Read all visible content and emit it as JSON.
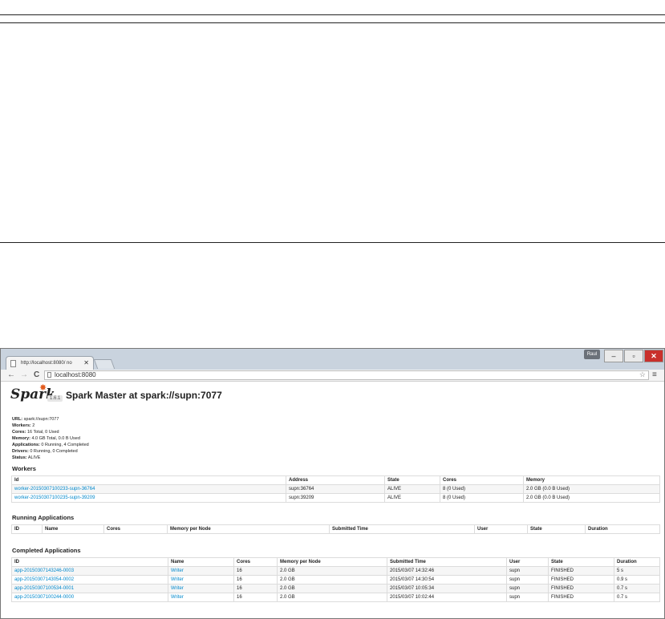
{
  "browser": {
    "tab_title": "http://localhost:8080/ no",
    "tab_close": "✕",
    "user": "Raul",
    "window_buttons": {
      "minimize": "‒",
      "maximize": "▫",
      "close": "✕"
    },
    "nav": {
      "back": "←",
      "forward": "→",
      "reload": "C"
    },
    "url": "localhost:8080",
    "star": "☆",
    "menu": "≡"
  },
  "page": {
    "logo_text": "Spark",
    "version": "1.6.1",
    "title": "Spark Master at spark://supn:7077",
    "info": [
      {
        "label": "URL:",
        "value": "spark://supn:7077"
      },
      {
        "label": "Workers:",
        "value": "2"
      },
      {
        "label": "Cores:",
        "value": "16 Total, 0 Used"
      },
      {
        "label": "Memory:",
        "value": "4.0 GB Total, 0.0 B Used"
      },
      {
        "label": "Applications:",
        "value": "0 Running, 4 Completed"
      },
      {
        "label": "Drivers:",
        "value": "0 Running, 0 Completed"
      },
      {
        "label": "Status:",
        "value": "ALIVE"
      }
    ]
  },
  "workers": {
    "title": "Workers",
    "columns": [
      "Id",
      "Address",
      "State",
      "Cores",
      "Memory"
    ],
    "rows": [
      [
        "worker-20150307100233-supn-36764",
        "supn:36764",
        "ALIVE",
        "8 (0 Used)",
        "2.0 GB (0.0 B Used)"
      ],
      [
        "worker-20150307100235-supn-39209",
        "supn:39209",
        "ALIVE",
        "8 (0 Used)",
        "2.0 GB (0.0 B Used)"
      ]
    ]
  },
  "running": {
    "title": "Running Applications",
    "columns": [
      "ID",
      "Name",
      "Cores",
      "Memory per Node",
      "Submitted Time",
      "User",
      "State",
      "Duration"
    ]
  },
  "completed": {
    "title": "Completed Applications",
    "columns": [
      "ID",
      "Name",
      "Cores",
      "Memory per Node",
      "Submitted Time",
      "User",
      "State",
      "Duration"
    ],
    "rows": [
      [
        "app-20150307143246-0003",
        "Writer",
        "16",
        "2.0 GB",
        "2015/03/07 14:32:46",
        "supn",
        "FINISHED",
        "5 s"
      ],
      [
        "app-20150307143054-0002",
        "Writer",
        "16",
        "2.0 GB",
        "2015/03/07 14:30:54",
        "supn",
        "FINISHED",
        "0.9 s"
      ],
      [
        "app-20150307100534-0001",
        "Writer",
        "16",
        "2.0 GB",
        "2015/03/07 10:05:34",
        "supn",
        "FINISHED",
        "0.7 s"
      ],
      [
        "app-20150307100244-0000",
        "Writer",
        "16",
        "2.0 GB",
        "2015/03/07 10:02:44",
        "supn",
        "FINISHED",
        "0.7 s"
      ]
    ]
  }
}
